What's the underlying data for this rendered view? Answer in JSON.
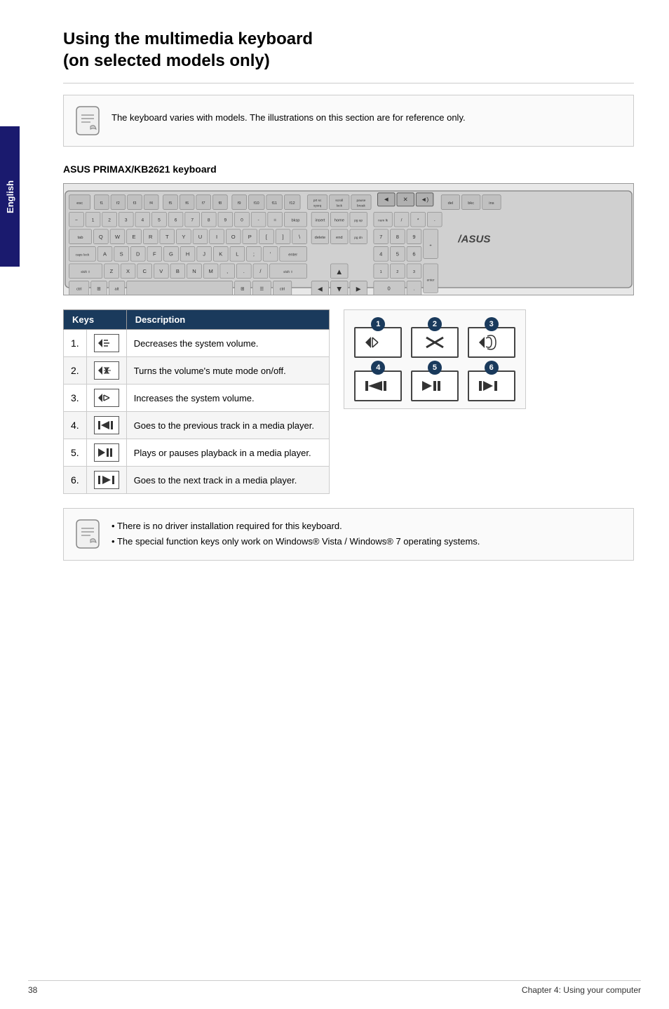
{
  "page": {
    "title_line1": "Using the multimedia keyboard",
    "title_line2": "(on selected models only)",
    "left_tab_label": "English",
    "note_text": "The keyboard varies with models. The illustrations on this section are for reference only.",
    "section_title": "ASUS PRIMAX/KB2621 keyboard",
    "table": {
      "col_keys": "Keys",
      "col_description": "Description",
      "rows": [
        {
          "num": "1.",
          "icon": "🔈",
          "icon_type": "vol-down",
          "description": "Decreases the system volume."
        },
        {
          "num": "2.",
          "icon": "🔇",
          "icon_type": "mute",
          "description": "Turns the volume's mute mode on/off."
        },
        {
          "num": "3.",
          "icon": "🔊",
          "icon_type": "vol-up",
          "description": "Increases the system volume."
        },
        {
          "num": "4.",
          "icon": "⏮",
          "icon_type": "prev",
          "description": "Goes to the previous track in a media player."
        },
        {
          "num": "5.",
          "icon": "⏯",
          "icon_type": "play",
          "description": "Plays or pauses playback in a media player."
        },
        {
          "num": "6.",
          "icon": "⏭",
          "icon_type": "next",
          "description": "Goes to the next track in a media player."
        }
      ]
    },
    "diagram": {
      "cells": [
        {
          "num": "1",
          "icon": "◄)"
        },
        {
          "num": "2",
          "icon": "✕"
        },
        {
          "num": "3",
          "icon": "◄))"
        },
        {
          "num": "4",
          "icon": "|◄◄"
        },
        {
          "num": "5",
          "icon": "►||"
        },
        {
          "num": "6",
          "icon": "►►|"
        }
      ]
    },
    "bottom_notes": [
      "There is no driver installation required for this keyboard.",
      "The special function keys only work on Windows® Vista / Windows® 7 operating systems."
    ],
    "footer": {
      "left": "38",
      "right": "Chapter 4: Using your computer"
    }
  }
}
